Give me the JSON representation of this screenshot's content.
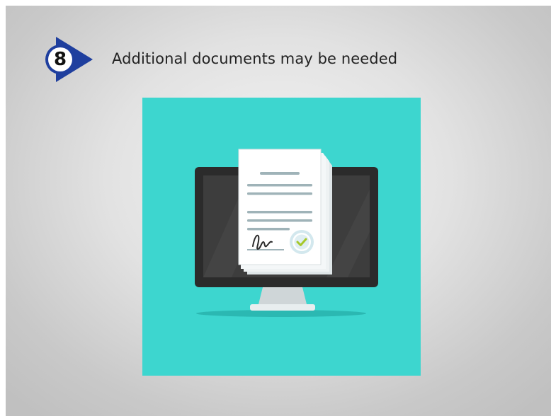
{
  "slide": {
    "step_number": "8",
    "title": "Additional documents may be needed",
    "badge_icon": "step-arrow-icon",
    "illustration_icon": "signed-document-on-monitor-icon"
  },
  "colors": {
    "badge_blue": "#1f3f9e",
    "illustration_background": "#3dd6cf",
    "monitor_frame": "#2b2b2b",
    "monitor_screen": "#3d3d3d",
    "check_green": "#a6c82a",
    "document_lines": "#9fb3b8"
  }
}
